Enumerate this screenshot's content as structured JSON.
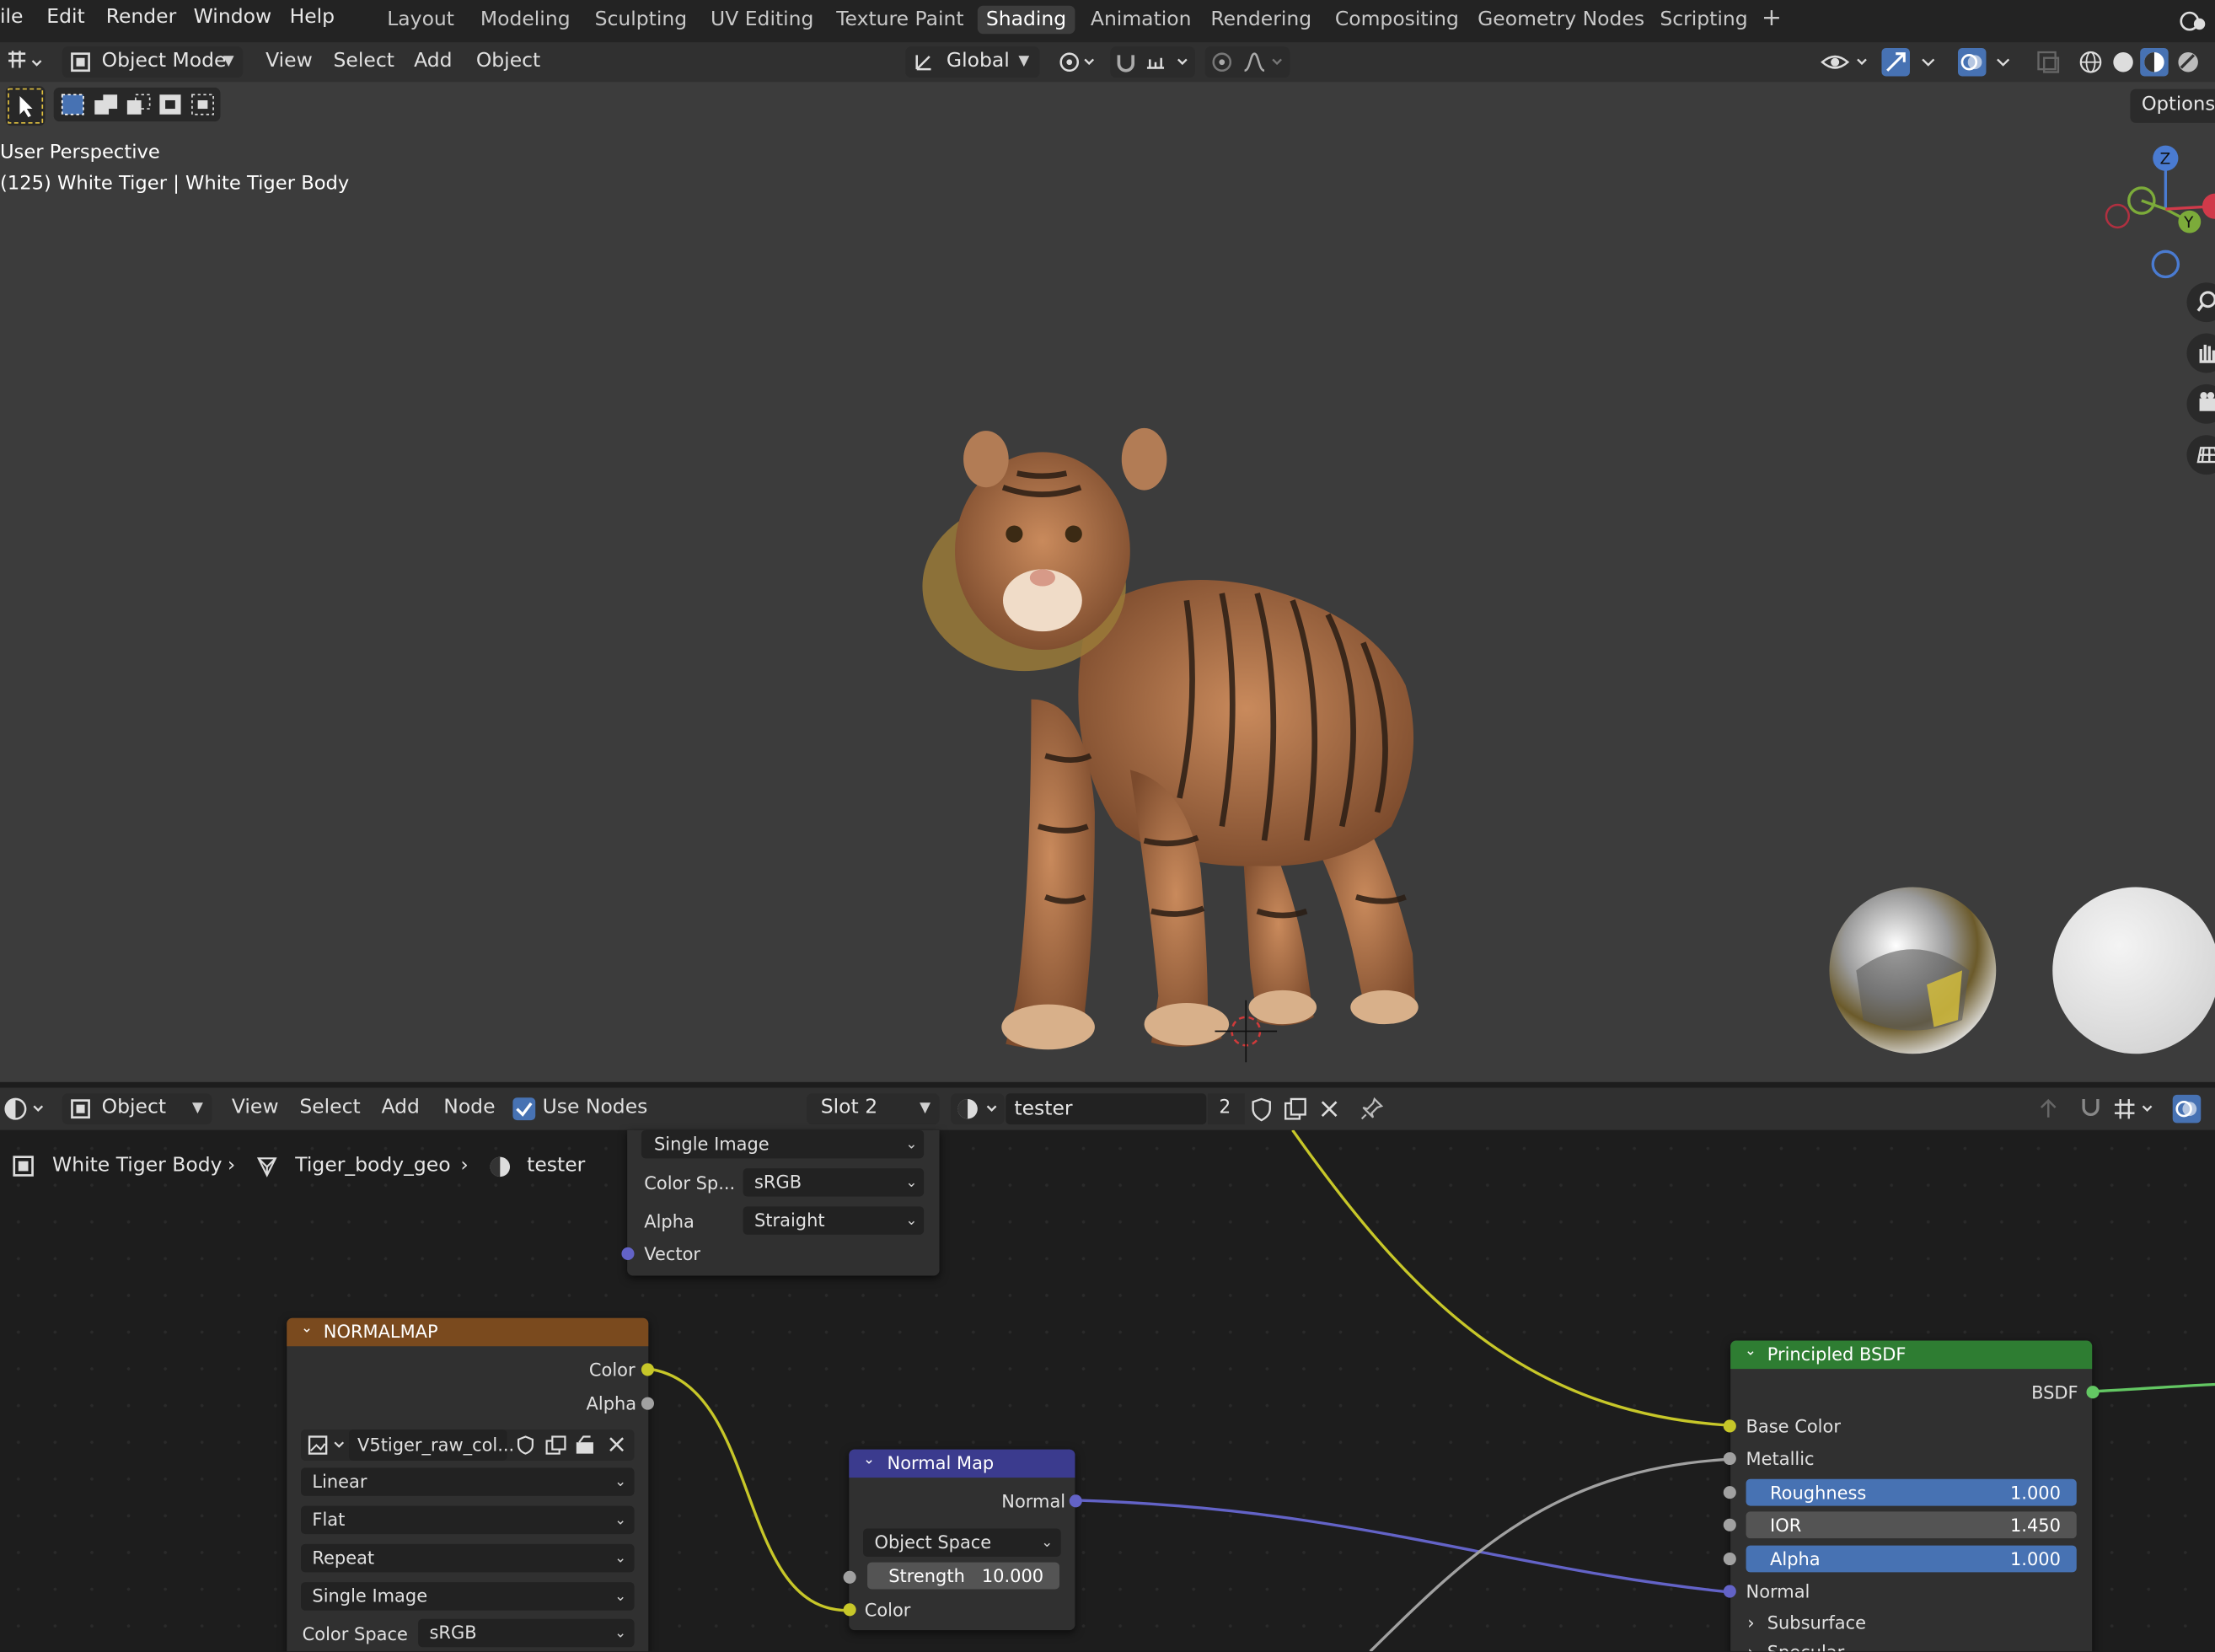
{
  "top_menu": {
    "file": "ile",
    "edit": "Edit",
    "render": "Render",
    "window": "Window",
    "help": "Help"
  },
  "workspace_tabs": [
    "Layout",
    "Modeling",
    "Sculpting",
    "UV Editing",
    "Texture Paint",
    "Shading",
    "Animation",
    "Rendering",
    "Compositing",
    "Geometry Nodes",
    "Scripting"
  ],
  "active_workspace": "Shading",
  "viewport_header": {
    "mode": "Object Mode",
    "menus": [
      "View",
      "Select",
      "Add",
      "Object"
    ],
    "transform_orientation": "Global",
    "options_label": "Options"
  },
  "viewport_overlay": {
    "perspective": "User Perspective",
    "object_info": "(125) White Tiger | White Tiger Body"
  },
  "gizmo": {
    "z": "Z",
    "y": "Y"
  },
  "node_editor_header": {
    "mode": "Object",
    "menus": [
      "View",
      "Select",
      "Add",
      "Node"
    ],
    "use_nodes_label": "Use Nodes",
    "slot": "Slot 2",
    "material_name": "tester",
    "user_count": "2"
  },
  "breadcrumb": [
    "White Tiger Body",
    "Tiger_body_geo",
    "tester"
  ],
  "nodes": {
    "image_top": {
      "projection": "Single Image",
      "color_space_label": "Color Sp...",
      "color_space": "sRGB",
      "alpha_label": "Alpha",
      "alpha": "Straight",
      "vector": "Vector"
    },
    "normalmap_image": {
      "title": "NORMALMAP",
      "out_color": "Color",
      "out_alpha": "Alpha",
      "image_name": "V5tiger_raw_col...",
      "interpolation": "Linear",
      "projection": "Flat",
      "extension": "Repeat",
      "source": "Single Image",
      "color_space_label": "Color Space",
      "color_space": "sRGB"
    },
    "normal_map": {
      "title": "Normal Map",
      "out_normal": "Normal",
      "space": "Object Space",
      "strength_label": "Strength",
      "strength": "10.000",
      "in_color": "Color"
    },
    "principled": {
      "title": "Principled BSDF",
      "out_bsdf": "BSDF",
      "base_color": "Base Color",
      "metallic": "Metallic",
      "roughness_label": "Roughness",
      "roughness": "1.000",
      "ior_label": "IOR",
      "ior": "1.450",
      "alpha_label": "Alpha",
      "alpha": "1.000",
      "normal": "Normal",
      "subsurface": "Subsurface",
      "specular": "Specular"
    }
  },
  "colors": {
    "header_image_node": "#7a4a1e",
    "header_vector_node": "#3b3b8e",
    "header_shader_node": "#2e7d32",
    "wire_yellow": "#c7c729",
    "wire_purple": "#6363c7",
    "wire_grey": "#a1a1a1",
    "active_field": "#4772b3"
  }
}
